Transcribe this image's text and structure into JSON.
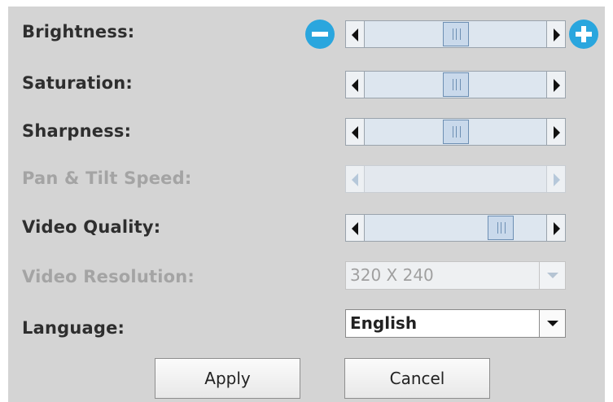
{
  "settings": {
    "brightness": {
      "label": "Brightness:",
      "value": 0.5
    },
    "saturation": {
      "label": "Saturation:",
      "value": 0.5
    },
    "sharpness": {
      "label": "Sharpness:",
      "value": 0.5
    },
    "pan_tilt_speed": {
      "label": "Pan & Tilt Speed:",
      "disabled": true
    },
    "video_quality": {
      "label": "Video Quality:",
      "value": 0.79
    },
    "video_resolution": {
      "label": "Video Resolution:",
      "selected": "320 X 240",
      "disabled": true
    },
    "language": {
      "label": "Language:",
      "selected": "English"
    }
  },
  "buttons": {
    "apply": "Apply",
    "cancel": "Cancel"
  },
  "icons": {
    "decrease": "minus-circle-icon",
    "increase": "plus-circle-icon",
    "scroll_left": "arrow-left-icon",
    "scroll_right": "arrow-right-icon",
    "dropdown": "chevron-down-icon"
  },
  "colors": {
    "accent": "#2aa6de",
    "panel": "#d4d4d4",
    "disabled_text": "#a4a4a4"
  }
}
